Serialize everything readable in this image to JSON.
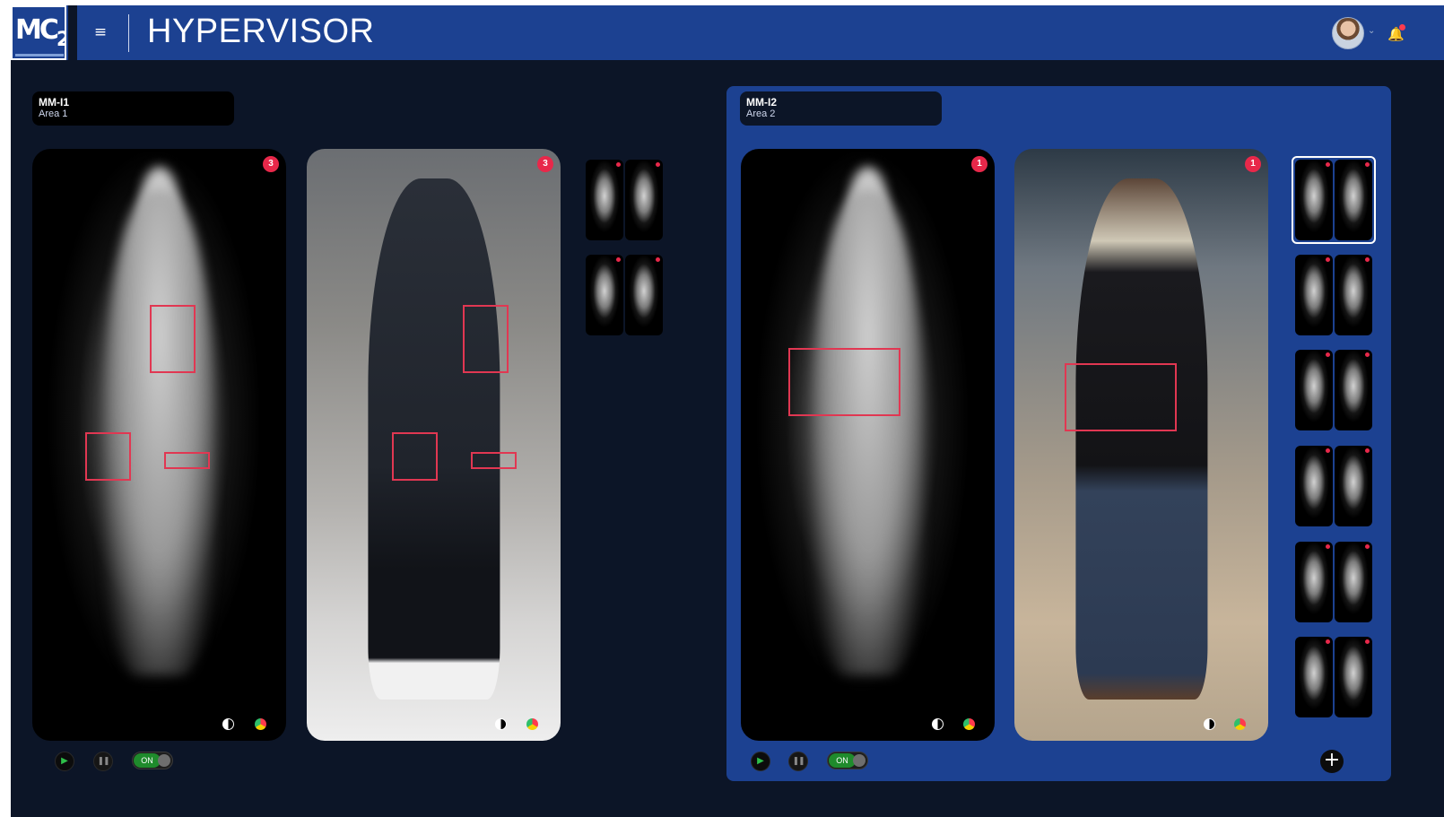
{
  "header": {
    "logo_text": "MC",
    "logo_sub": "2",
    "title": "HYPERVISOR",
    "menu_icon": "≡",
    "bell_icon": "🔔"
  },
  "units": [
    {
      "name": "MM-I1",
      "area": "Area 1",
      "scan_badge": "3",
      "photo_badge": "3",
      "toggle_label": "ON"
    },
    {
      "name": "MM-I2",
      "area": "Area 2",
      "scan_badge": "1",
      "photo_badge": "1",
      "toggle_label": "ON"
    }
  ],
  "controls": {
    "play_icon": "▶",
    "pause_icon": "❚❚",
    "add_icon": "+"
  },
  "colors": {
    "header_bg": "#1c4191",
    "page_bg": "#0c1527",
    "alert_red": "#e8284a",
    "toggle_green": "#1f8b2c"
  }
}
